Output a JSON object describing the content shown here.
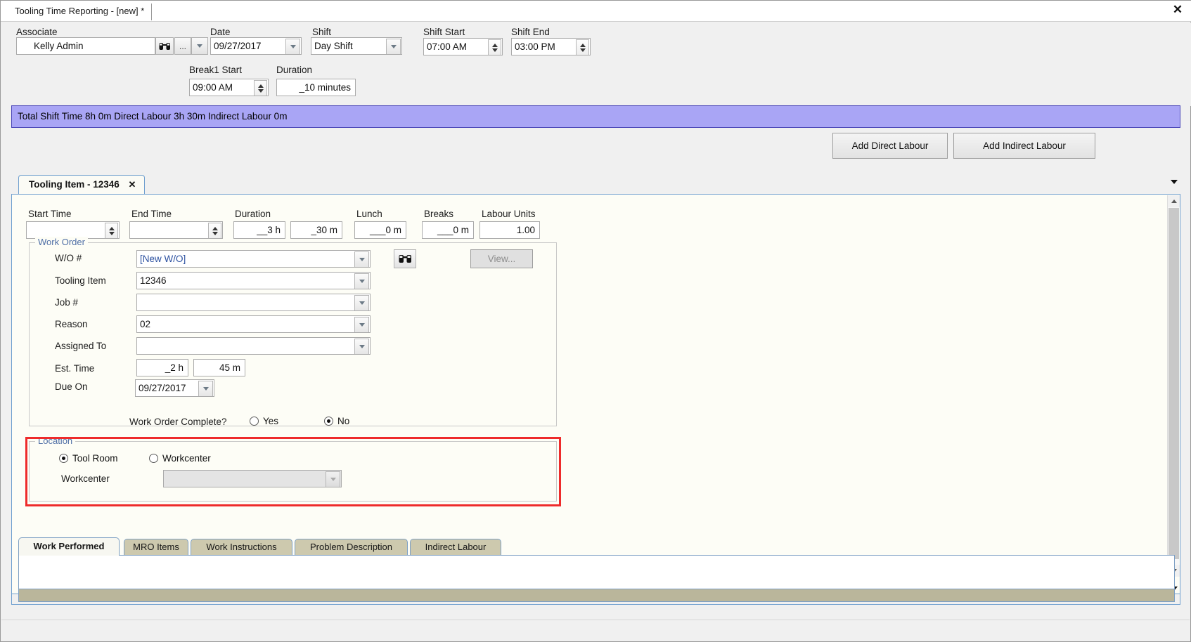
{
  "window": {
    "tab_title": "Tooling Time Reporting - [new] *",
    "close_icon": "close-icon"
  },
  "header": {
    "associate": {
      "label": "Associate",
      "value": "Kelly Admin",
      "find_icon": "binoculars-icon",
      "ellipsis_label": "..."
    },
    "date": {
      "label": "Date",
      "value": "09/27/2017"
    },
    "shift": {
      "label": "Shift",
      "value": "Day Shift"
    },
    "shift_start": {
      "label": "Shift Start",
      "value": "07:00 AM"
    },
    "shift_end": {
      "label": "Shift End",
      "value": "03:00 PM"
    },
    "break1_start": {
      "label": "Break1 Start",
      "value": "09:00 AM"
    },
    "break1_duration": {
      "label": "Duration",
      "value": "_10 minutes"
    }
  },
  "summary": {
    "text": "Total Shift Time 8h 0m  Direct Labour 3h 30m  Indirect Labour 0m",
    "background": "#a9a5f5"
  },
  "actions": {
    "add_direct_labour": "Add Direct Labour",
    "add_indirect_labour": "Add Indirect Labour"
  },
  "item_tab": {
    "label": "Tooling Item - 12346",
    "close_glyph": "✕"
  },
  "time_row": {
    "start_time": {
      "label": "Start Time",
      "value": ""
    },
    "end_time": {
      "label": "End Time",
      "value": ""
    },
    "duration": {
      "label": "Duration",
      "hours": "__3 h",
      "minutes": "_30 m"
    },
    "lunch": {
      "label": "Lunch",
      "value": "___0 m"
    },
    "breaks": {
      "label": "Breaks",
      "value": "___0 m"
    },
    "labour_units": {
      "label": "Labour Units",
      "value": "1.00"
    }
  },
  "work_order": {
    "legend": "Work Order",
    "wo_number": {
      "label": "W/O #",
      "value": "[New W/O]"
    },
    "find_icon": "binoculars-icon",
    "view_button": "View...",
    "tooling_item": {
      "label": "Tooling Item",
      "value": "12346"
    },
    "job_number": {
      "label": "Job #",
      "value": ""
    },
    "reason": {
      "label": "Reason",
      "value": "02"
    },
    "assigned_to": {
      "label": "Assigned To",
      "value": ""
    },
    "est_time": {
      "label": "Est. Time",
      "hours": "_2 h",
      "minutes": "45 m"
    },
    "due_on": {
      "label": "Due On",
      "value": "09/27/2017"
    },
    "complete": {
      "label": "Work Order Complete?",
      "yes_label": "Yes",
      "no_label": "No",
      "selected": "No"
    }
  },
  "location": {
    "legend": "Location",
    "tool_room_label": "Tool Room",
    "workcenter_radio_label": "Workcenter",
    "workcenter_field_label": "Workcenter",
    "workcenter_value": "",
    "selected": "Tool Room",
    "highlight_color": "#ee2b2b"
  },
  "bottom_tabs": {
    "items": [
      {
        "label": "Work Performed",
        "active": true
      },
      {
        "label": "MRO Items",
        "active": false
      },
      {
        "label": "Work Instructions",
        "active": false
      },
      {
        "label": "Problem Description",
        "active": false
      },
      {
        "label": "Indirect Labour",
        "active": false
      }
    ],
    "content": ""
  }
}
